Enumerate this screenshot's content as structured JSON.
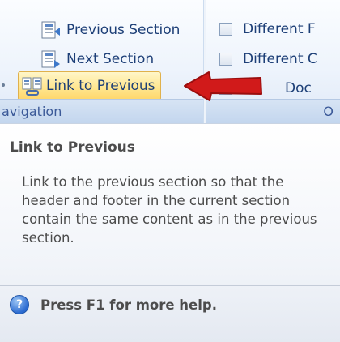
{
  "navigation": {
    "previous_section": "Previous Section",
    "next_section": "Next Section",
    "link_to_previous": "Link to Previous",
    "group_label": "avigation"
  },
  "options": {
    "different_first": "Different F",
    "different_odd_even": "Different C",
    "show_document": "Doc",
    "group_label": "O"
  },
  "tooltip": {
    "title": "Link to Previous",
    "body": "Link to the previous section so that the header and footer in the current section contain the same content as in the previous section.",
    "help": "Press F1 for more help."
  },
  "colors": {
    "annotation_arrow": "#d11a1a",
    "highlight_button": "#ffe58c"
  },
  "icons": [
    "previous-section-icon",
    "next-section-icon",
    "link-to-previous-icon",
    "checkbox",
    "help-icon",
    "red-arrow"
  ]
}
